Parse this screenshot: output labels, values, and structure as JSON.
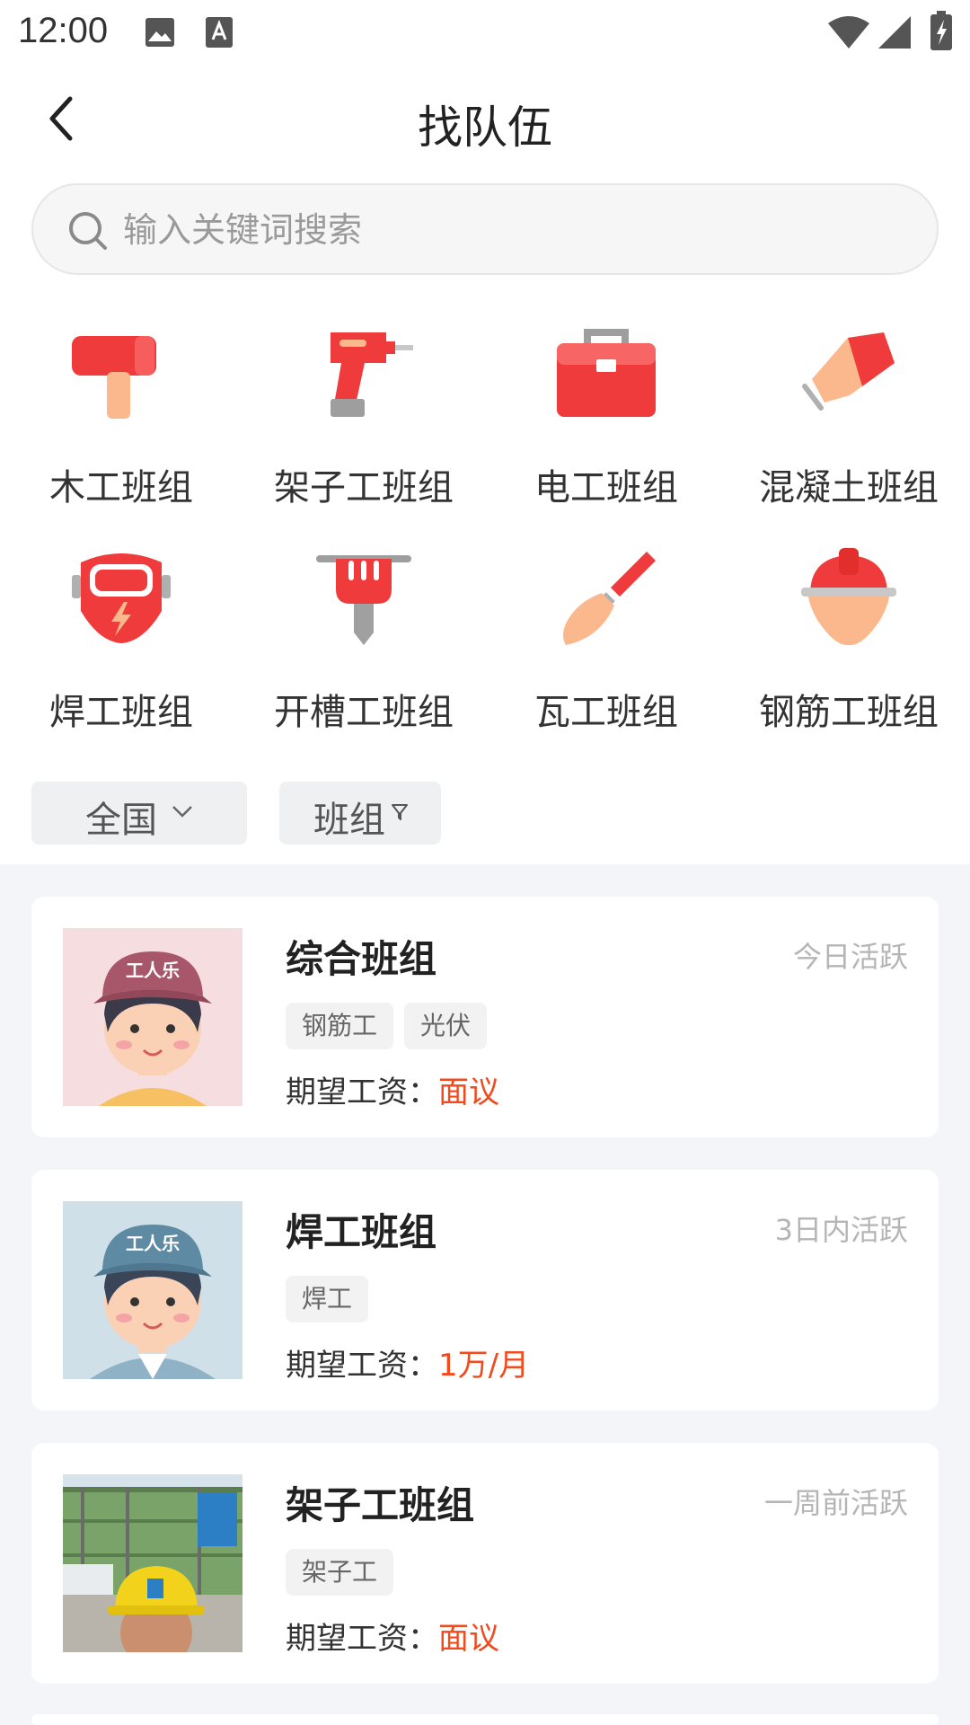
{
  "status_bar": {
    "time": "12:00"
  },
  "header": {
    "title": "找队伍"
  },
  "search": {
    "placeholder": "输入关键词搜索"
  },
  "categories": [
    {
      "label": "木工班组",
      "icon": "hammer-icon"
    },
    {
      "label": "架子工班组",
      "icon": "drill-icon"
    },
    {
      "label": "电工班组",
      "icon": "toolbox-icon"
    },
    {
      "label": "混凝土班组",
      "icon": "trowel-float-icon"
    },
    {
      "label": "焊工班组",
      "icon": "welding-mask-icon"
    },
    {
      "label": "开槽工班组",
      "icon": "jackhammer-icon"
    },
    {
      "label": "瓦工班组",
      "icon": "trowel-icon"
    },
    {
      "label": "钢筋工班组",
      "icon": "hard-hat-icon"
    }
  ],
  "filters": {
    "region": "全国",
    "type": "班组"
  },
  "teams": [
    {
      "name": "综合班组",
      "active": "今日活跃",
      "tags": [
        "钢筋工",
        "光伏"
      ],
      "wage_label": "期望工资：",
      "wage": "面议",
      "avatar": "worker-avatar-pink"
    },
    {
      "name": "焊工班组",
      "active": "3日内活跃",
      "tags": [
        "焊工"
      ],
      "wage_label": "期望工资：",
      "wage": "1万/月",
      "avatar": "worker-avatar-blue"
    },
    {
      "name": "架子工班组",
      "active": "一周前活跃",
      "tags": [
        "架子工"
      ],
      "wage_label": "期望工资：",
      "wage": "面议",
      "avatar": "worker-photo"
    }
  ],
  "avatar_cap_text": "工人乐",
  "colors": {
    "accent": "#f24a1d",
    "icon_red": "#ef3b3b",
    "icon_peach": "#fbb88c"
  }
}
